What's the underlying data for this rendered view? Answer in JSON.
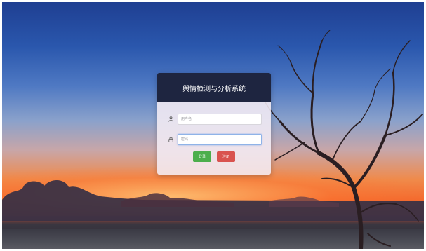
{
  "app": {
    "title": "舆情检测与分析系统"
  },
  "login": {
    "username_placeholder": "用户名",
    "password_placeholder": "密码",
    "login_label": "登录",
    "register_label": "注册"
  },
  "icons": {
    "username": "user-icon",
    "password": "lock-icon"
  },
  "colors": {
    "header_bg": "#1e2540",
    "login_button": "#4cae4c",
    "register_button": "#d9534f"
  }
}
